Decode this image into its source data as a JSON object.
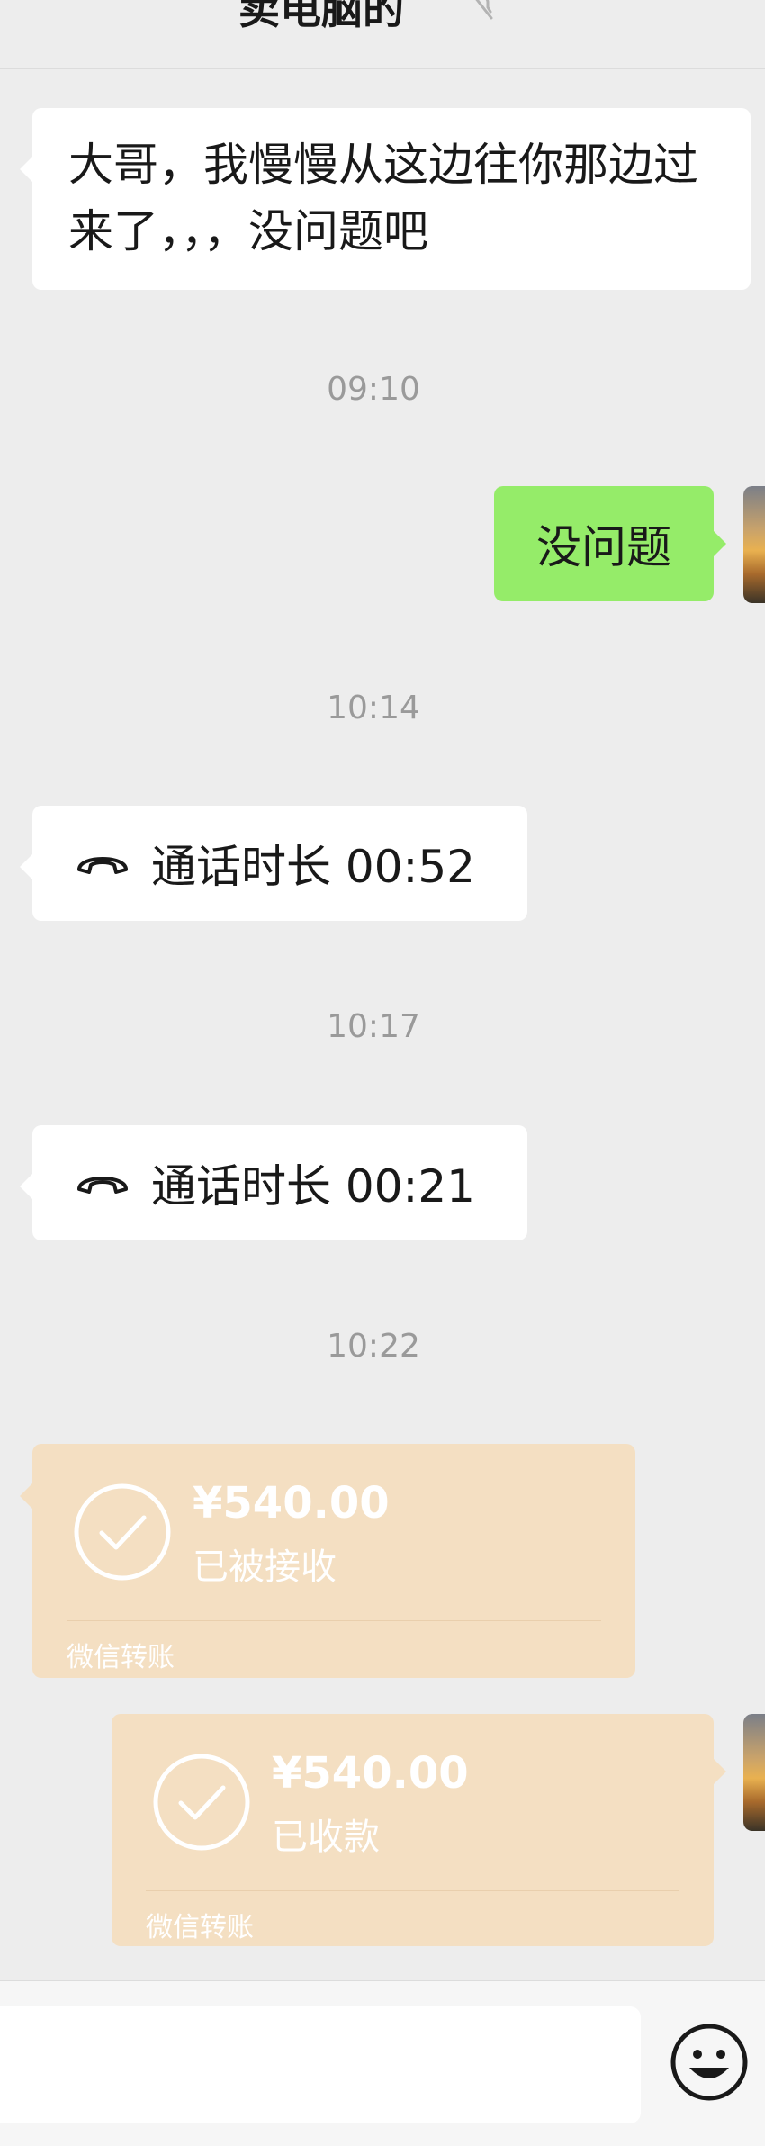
{
  "header": {
    "title": "卖电脑的"
  },
  "messages": {
    "m1": "大哥，我慢慢从这边往你那边过来了，，，没问题吧",
    "t1": "09:10",
    "m2": "没问题",
    "t2": "10:14",
    "call1": "通话时长 00:52",
    "t3": "10:17",
    "call2": "通话时长 00:21",
    "t4": "10:22"
  },
  "transfers": {
    "received": {
      "amount": "¥540.00",
      "status": "已被接收",
      "brand": "微信转账"
    },
    "collected": {
      "amount": "¥540.00",
      "status": "已收款",
      "brand": "微信转账"
    }
  },
  "colors": {
    "background": "#ededed",
    "sent_bubble": "#95ec69",
    "received_bubble": "#ffffff",
    "transfer_bubble": "#f4dfc2"
  },
  "icons": [
    "mute-icon",
    "phone-hangup-icon",
    "check-circle-icon",
    "emoji-icon"
  ]
}
